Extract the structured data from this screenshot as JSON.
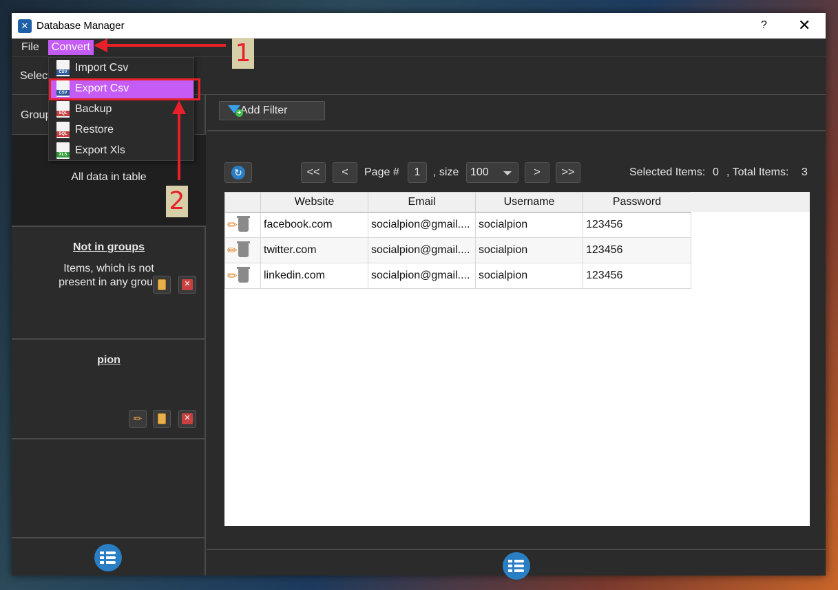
{
  "window": {
    "title": "Database Manager",
    "help": "?",
    "close": "✕"
  },
  "menu": {
    "file": "File",
    "convert": "Convert"
  },
  "convert_menu": [
    {
      "label": "Import Csv",
      "icon": "csv-file-icon",
      "badge": "CSV"
    },
    {
      "label": "Export Csv",
      "icon": "csv-file-icon",
      "badge": "CSV"
    },
    {
      "label": "Backup",
      "icon": "sql-file-icon",
      "badge": "SQL"
    },
    {
      "label": "Restore",
      "icon": "sql-file-icon",
      "badge": "SQL"
    },
    {
      "label": "Export Xls",
      "icon": "xls-file-icon",
      "badge": "XLS"
    }
  ],
  "toolbar": {
    "select_label": "Select"
  },
  "left": {
    "group_label": "Group",
    "all_data": "All data in table",
    "not_in_groups_title": "Not in groups",
    "not_in_groups_desc_1": "Items, which is not",
    "not_in_groups_desc_2": "present in any group",
    "pion_title": "pion"
  },
  "filter": {
    "add_filter": "Add Filter"
  },
  "pager": {
    "first": "<<",
    "prev": "<",
    "page_label": "Page #",
    "page": "1",
    "size_label": ", size",
    "size": "100",
    "next": ">",
    "last": ">>",
    "selected_label": "Selected Items:",
    "selected": "0",
    "total_label": ", Total Items:",
    "total": "3"
  },
  "table": {
    "columns": [
      "Website",
      "Email",
      "Username",
      "Password"
    ],
    "rows": [
      [
        "facebook.com",
        "socialpion@gmail....",
        "socialpion",
        "123456"
      ],
      [
        "twitter.com",
        "socialpion@gmail....",
        "socialpion",
        "123456"
      ],
      [
        "linkedin.com",
        "socialpion@gmail....",
        "socialpion",
        "123456"
      ]
    ]
  },
  "annotations": {
    "step1": "1",
    "step2": "2"
  },
  "colors": {
    "menu_highlight": "#c45cf5",
    "annotation": "#e8202a",
    "accent_blue": "#2a7fc4"
  }
}
